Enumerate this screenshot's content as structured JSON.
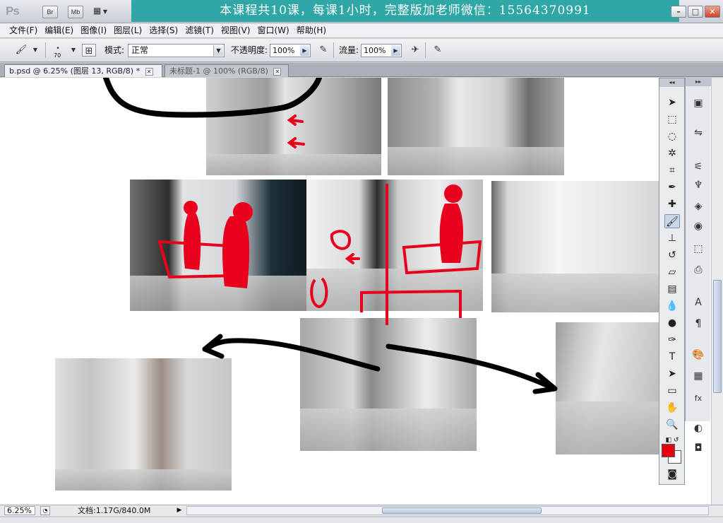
{
  "app": {
    "logo": "Ps",
    "bridge_label": "Br",
    "minibridge_label": "Mb",
    "banner": "本课程共10课，每课1小时，完整版加老师微信：15564370991"
  },
  "menu": [
    "文件(F)",
    "编辑(E)",
    "图像(I)",
    "图层(L)",
    "选择(S)",
    "滤镜(T)",
    "视图(V)",
    "窗口(W)",
    "帮助(H)"
  ],
  "options": {
    "brush_size": "70",
    "mode_label": "模式:",
    "mode_value": "正常",
    "opacity_label": "不透明度:",
    "opacity_value": "100%",
    "flow_label": "流量:",
    "flow_value": "100%"
  },
  "tabs": [
    {
      "label": "b.psd @ 6.25% (图层 13, RGB/8) *",
      "active": true
    },
    {
      "label": "未标题-1 @ 100% (RGB/8)",
      "active": false
    }
  ],
  "status": {
    "zoom": "6.25%",
    "doc_info": "文档:1.17G/840.0M"
  },
  "colors": {
    "foreground": "#e60012",
    "background": "#ffffff",
    "banner": "#2fa7a7",
    "annotation_red": "#e8001c",
    "annotation_black": "#000000"
  }
}
